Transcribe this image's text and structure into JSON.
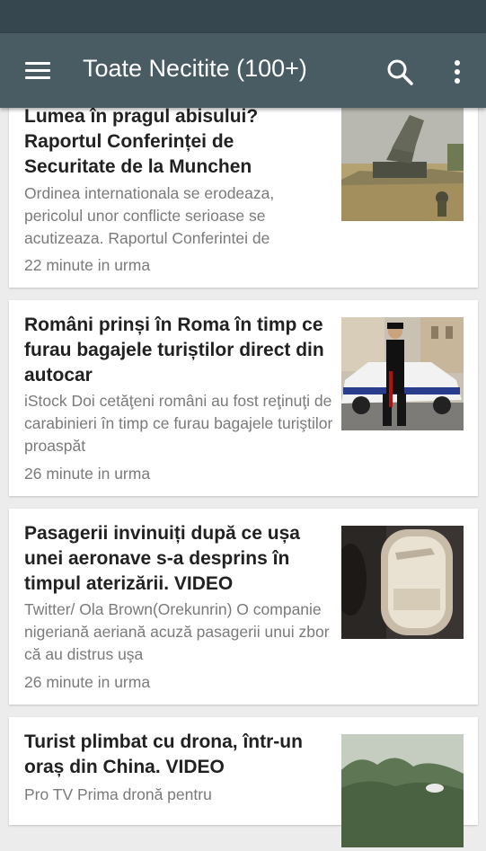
{
  "app_bar": {
    "title": "Toate Necitite (100+)",
    "icons": {
      "menu": "menu-icon",
      "search": "search-icon",
      "more": "more-vert-icon"
    }
  },
  "colors": {
    "status_bar": "#37474f",
    "app_bar": "#4a5c63",
    "background": "#ececec"
  },
  "articles": [
    {
      "title": "Lumea în pragul abisului? Raportul Conferinței de Securitate de la Munchen",
      "excerpt": "Ordinea internationala se erodeaza, pericolul unor conflicte serioase se acutizeaza. Raportul Conferintei de",
      "time": "22 minute in urma",
      "thumbnail": "missile-launcher-field-image"
    },
    {
      "title": "Români prinși în Roma în timp ce furau bagajele turiștilor direct din autocar",
      "excerpt": "iStock Doi cetăţeni români au fost reţinuţi de carabinieri în timp ce furau bagajele turiştilor proaspăt",
      "time": "26 minute in urma",
      "thumbnail": "carabinieri-police-car-image"
    },
    {
      "title": "Pasagerii invinuiți după ce ușa unei aeronave s-a desprins în timpul aterizării. VIDEO",
      "excerpt": "Twitter/ Ola Brown(Orekunrin) O companie nigeriană aeriană acuză pasagerii unui zbor că au distrus uşa",
      "time": "26 minute in urma",
      "thumbnail": "airplane-window-image"
    },
    {
      "title": "Turist plimbat cu drona, într-un oraș din China. VIDEO",
      "excerpt": "Pro TV Prima dronă pentru",
      "time": "",
      "thumbnail": "drone-over-trees-image"
    }
  ]
}
